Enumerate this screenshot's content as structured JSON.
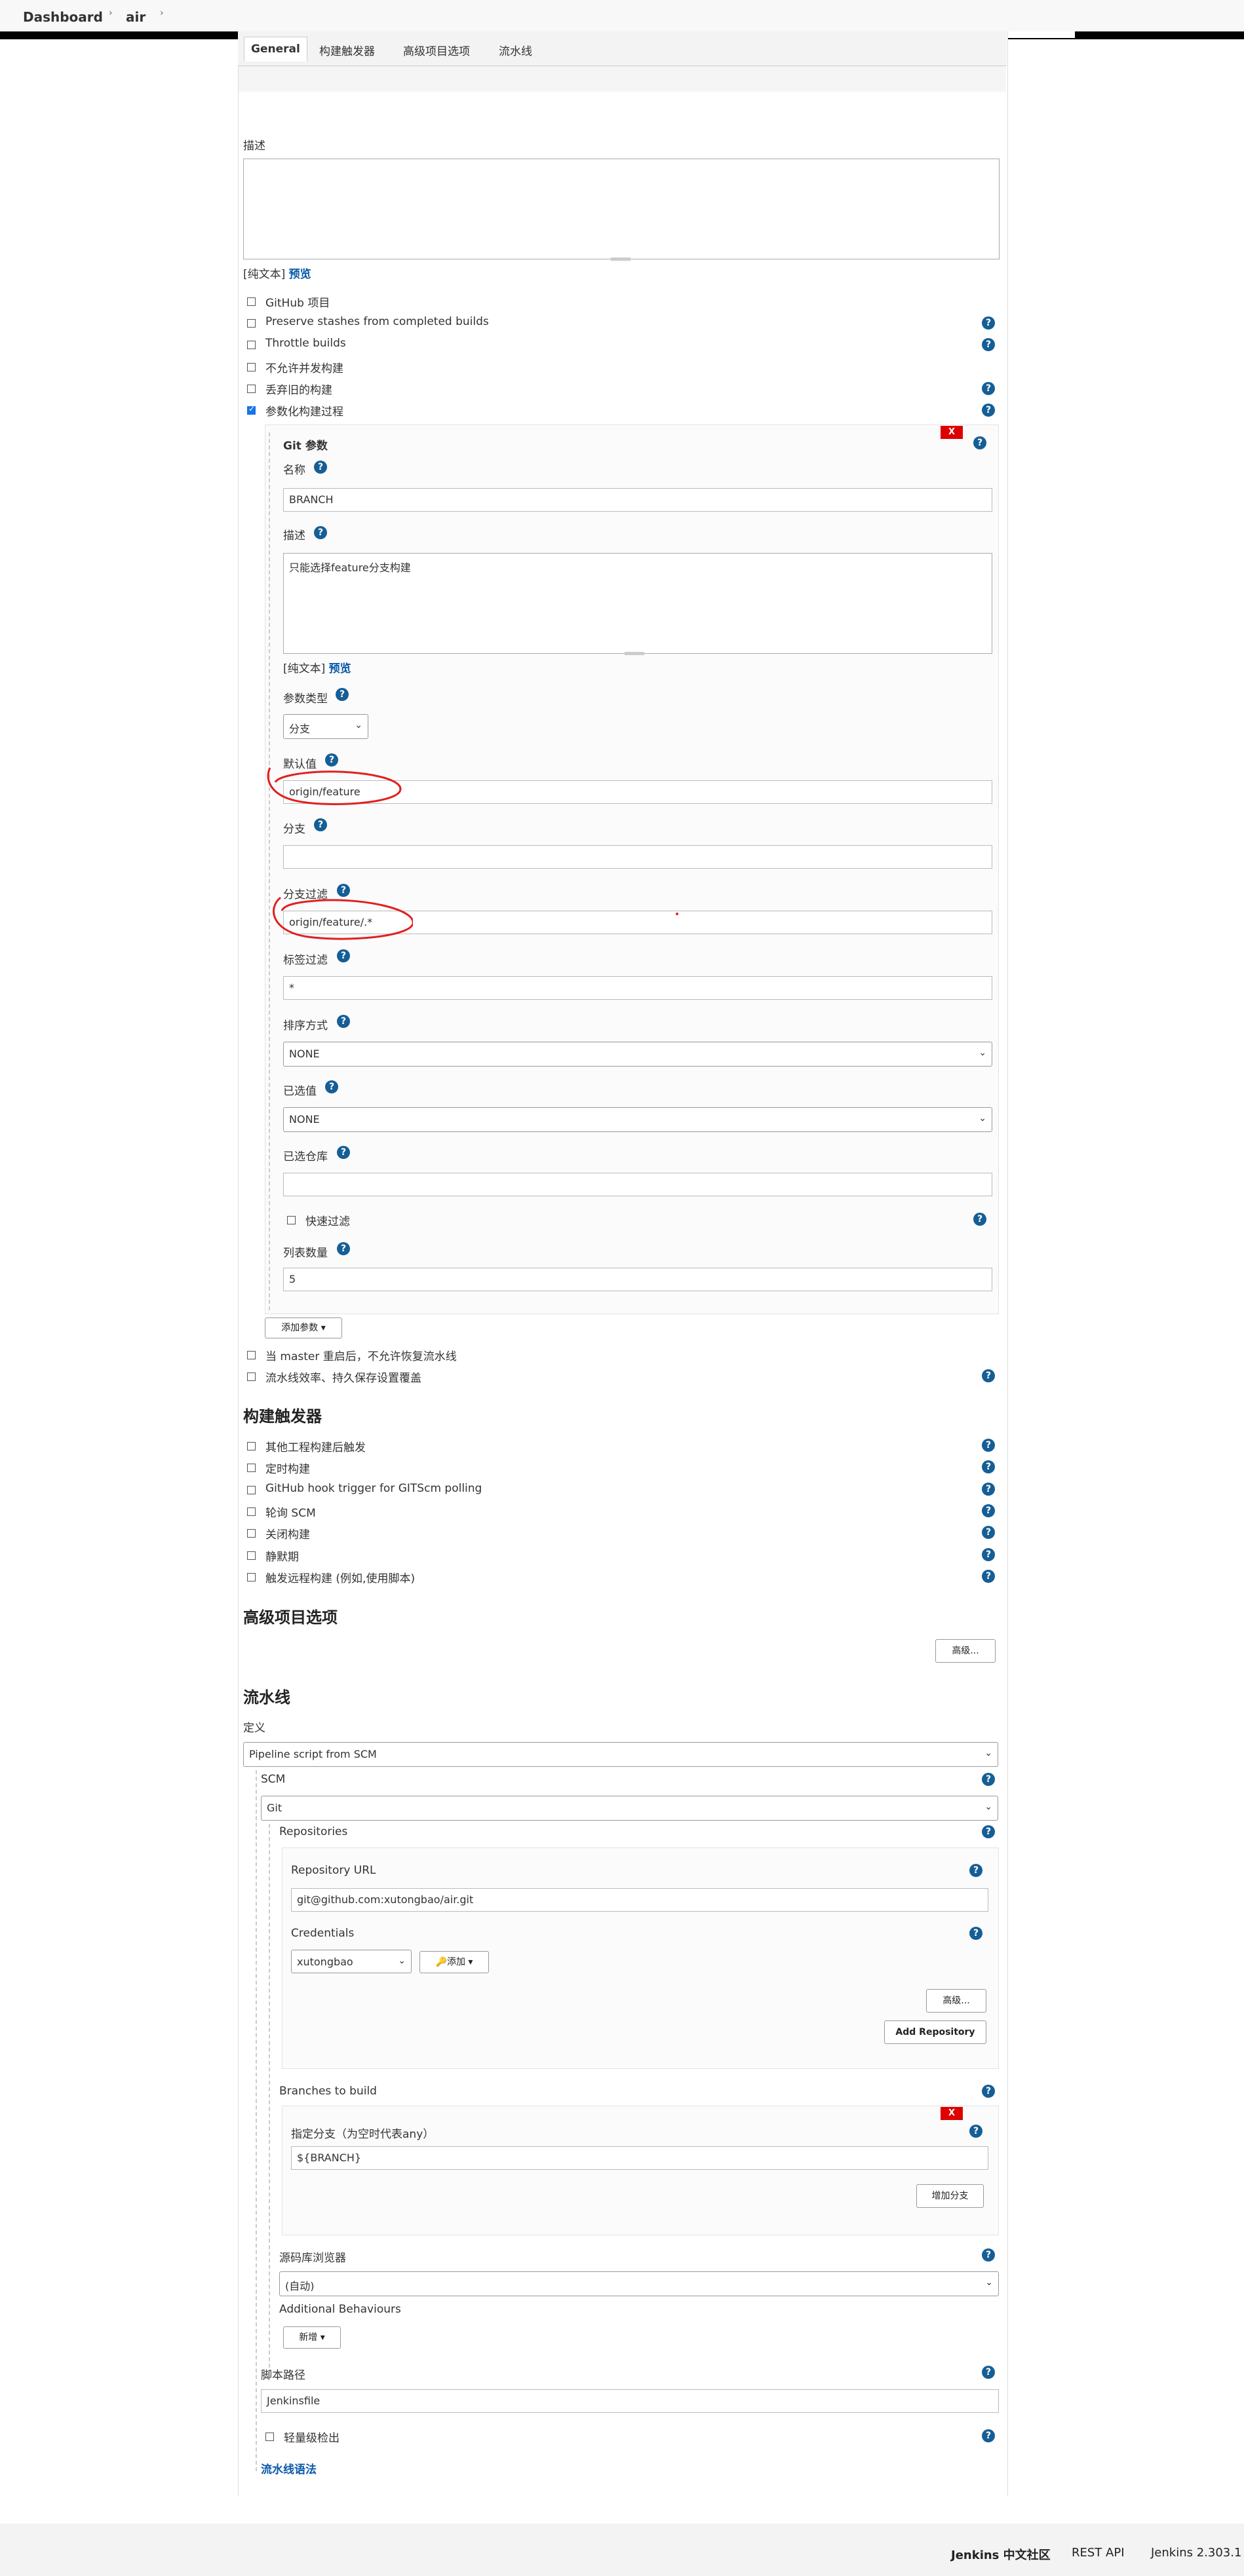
{
  "breadcrumb": {
    "items": [
      "Dashboard",
      "air"
    ],
    "sep": "›"
  },
  "tabs": [
    "General",
    "构建触发器",
    "高级项目选项",
    "流水线"
  ],
  "general": {
    "desc_label": "描述",
    "plain_text": "[纯文本]",
    "preview": "预览",
    "options": [
      {
        "label": "GitHub 项目",
        "checked": false
      },
      {
        "label": "Preserve stashes from completed builds",
        "checked": false
      },
      {
        "label": "Throttle builds",
        "checked": false
      },
      {
        "label": "不允许并发构建",
        "checked": false
      },
      {
        "label": "丢弃旧的构建",
        "checked": false
      },
      {
        "label": "参数化构建过程",
        "checked": true
      }
    ],
    "git_param": {
      "title": "Git 参数",
      "x_label": "X",
      "name_label": "名称",
      "name_value": "BRANCH",
      "desc_label": "描述",
      "desc_value": "只能选择feature分支构建",
      "plain_text": "[纯文本]",
      "preview": "预览",
      "type_label": "参数类型",
      "type_value": "分支",
      "default_label": "默认值",
      "default_value": "origin/feature",
      "branch_label": "分支",
      "branch_value": "",
      "branch_filter_label": "分支过滤",
      "branch_filter_value": "origin/feature/.*",
      "tag_filter_label": "标签过滤",
      "tag_filter_value": "*",
      "sort_label": "排序方式",
      "sort_value": "NONE",
      "selected_label": "已选值",
      "selected_value": "NONE",
      "repo_label": "已选仓库",
      "repo_value": "",
      "quick_filter": "快速过滤",
      "list_count_label": "列表数量",
      "list_count_value": "5"
    },
    "add_param": "添加参数 ▾",
    "after_options": [
      {
        "label": "当 master 重启后，不允许恢复流水线",
        "checked": false
      },
      {
        "label": "流水线效率、持久保存设置覆盖",
        "checked": false
      }
    ]
  },
  "triggers": {
    "title": "构建触发器",
    "options": [
      {
        "label": "其他工程构建后触发",
        "checked": false
      },
      {
        "label": "定时构建",
        "checked": false
      },
      {
        "label": "GitHub hook trigger for GITScm polling",
        "checked": false
      },
      {
        "label": "轮询 SCM",
        "checked": false
      },
      {
        "label": "关闭构建",
        "checked": false
      },
      {
        "label": "静默期",
        "checked": false
      },
      {
        "label": "触发远程构建 (例如,使用脚本)",
        "checked": false
      }
    ]
  },
  "advanced": {
    "title": "高级项目选项",
    "button": "高级..."
  },
  "pipeline": {
    "title": "流水线",
    "def_label": "定义",
    "def_value": "Pipeline script from SCM",
    "scm_label": "SCM",
    "scm_value": "Git",
    "repos_label": "Repositories",
    "repo_url_label": "Repository URL",
    "repo_url_value": "git@github.com:xutongbao/air.git",
    "cred_label": "Credentials",
    "cred_value": "xutongbao",
    "cred_add": "🔑添加 ▾",
    "adv_button": "高级...",
    "add_repo": "Add Repository",
    "branches_label": "Branches to build",
    "branch_x": "X",
    "branch_spec_label": "指定分支（为空时代表any）",
    "branch_spec_value": "${BRANCH}",
    "add_branch": "增加分支",
    "browser_label": "源码库浏览器",
    "browser_value": "(自动)",
    "behaviours_label": "Additional Behaviours",
    "behaviours_add": "新增 ▾",
    "script_path_label": "脚本路径",
    "script_path_value": "Jenkinsfile",
    "lightweight": "轻量级检出",
    "syntax_link": "流水线语法"
  },
  "footer": {
    "community": "Jenkins 中文社区",
    "rest": "REST API",
    "version": "Jenkins 2.303.1"
  },
  "colors": {
    "help": "#155e96",
    "link": "#0a59a8",
    "x_button": "#dd0000",
    "annotation": "#e02020"
  }
}
